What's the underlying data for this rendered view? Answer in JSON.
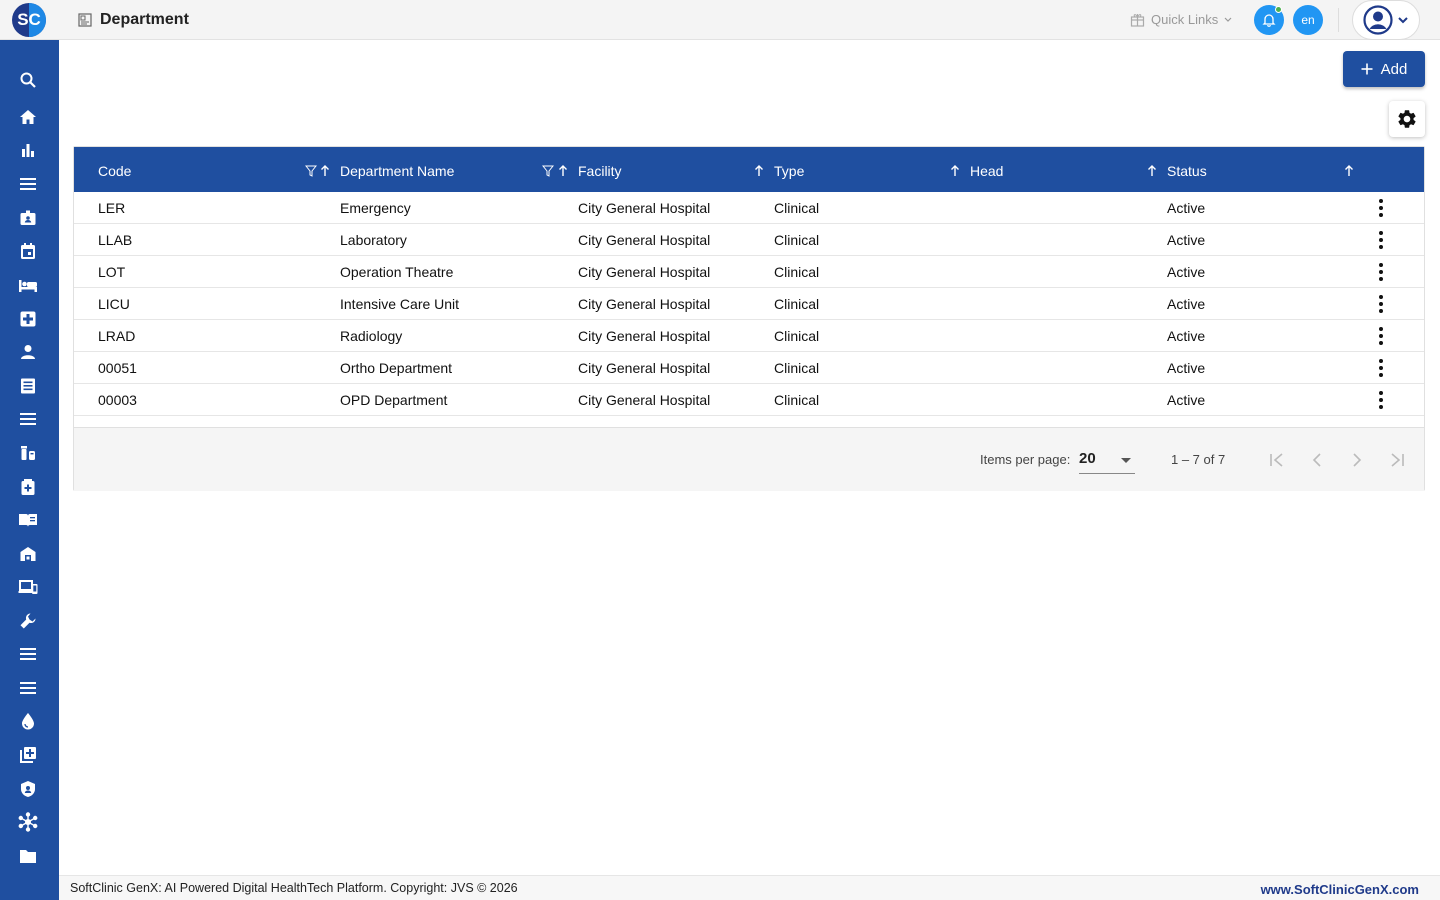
{
  "header": {
    "logo_text": "SC",
    "page_title": "Department",
    "quick_links_label": "Quick Links",
    "lang_label": "en"
  },
  "sidebar": {
    "items": [
      {
        "icon": "search-icon"
      },
      {
        "icon": "home-icon"
      },
      {
        "icon": "bar-chart-icon"
      },
      {
        "icon": "menu-icon"
      },
      {
        "icon": "badge-icon"
      },
      {
        "icon": "calendar-icon"
      },
      {
        "icon": "bed-icon"
      },
      {
        "icon": "medical-plus-icon"
      },
      {
        "icon": "person-icon"
      },
      {
        "icon": "document-list-icon"
      },
      {
        "icon": "menu-icon"
      },
      {
        "icon": "medicine-icon"
      },
      {
        "icon": "medical-bag-icon"
      },
      {
        "icon": "book-icon"
      },
      {
        "icon": "building-icon"
      },
      {
        "icon": "devices-icon"
      },
      {
        "icon": "wrench-icon"
      },
      {
        "icon": "menu-icon"
      },
      {
        "icon": "menu-icon"
      },
      {
        "icon": "blood-drop-icon"
      },
      {
        "icon": "add-library-icon"
      },
      {
        "icon": "shield-icon"
      },
      {
        "icon": "hub-icon"
      },
      {
        "icon": "folder-icon"
      }
    ]
  },
  "toolbar": {
    "add_label": "Add"
  },
  "table": {
    "columns": [
      "Code",
      "Department Name",
      "Facility",
      "Type",
      "Head",
      "Status"
    ],
    "rows": [
      {
        "code": "LER",
        "name": "Emergency",
        "facility": "City General Hospital",
        "type": "Clinical",
        "head": "",
        "status": "Active"
      },
      {
        "code": "LLAB",
        "name": "Laboratory",
        "facility": "City General Hospital",
        "type": "Clinical",
        "head": "",
        "status": "Active"
      },
      {
        "code": "LOT",
        "name": "Operation Theatre",
        "facility": "City General Hospital",
        "type": "Clinical",
        "head": "",
        "status": "Active"
      },
      {
        "code": "LICU",
        "name": "Intensive Care Unit",
        "facility": "City General Hospital",
        "type": "Clinical",
        "head": "",
        "status": "Active"
      },
      {
        "code": "LRAD",
        "name": "Radiology",
        "facility": "City General Hospital",
        "type": "Clinical",
        "head": "",
        "status": "Active"
      },
      {
        "code": "00051",
        "name": "Ortho Department",
        "facility": "City General Hospital",
        "type": "Clinical",
        "head": "",
        "status": "Active"
      },
      {
        "code": "00003",
        "name": "OPD Department",
        "facility": "City General Hospital",
        "type": "Clinical",
        "head": "",
        "status": "Active"
      }
    ]
  },
  "paginator": {
    "items_per_page_label": "Items per page:",
    "items_per_page_value": "20",
    "range_label": "1 – 7 of 7"
  },
  "footer": {
    "copyright": "SoftClinic GenX: AI Powered Digital HealthTech Platform. Copyright: JVS © 2026",
    "website": "www.SoftClinicGenX.com"
  },
  "colors": {
    "primary": "#1f4fa0",
    "accent": "#2196f3",
    "logo_dark": "#1f3a8a"
  }
}
